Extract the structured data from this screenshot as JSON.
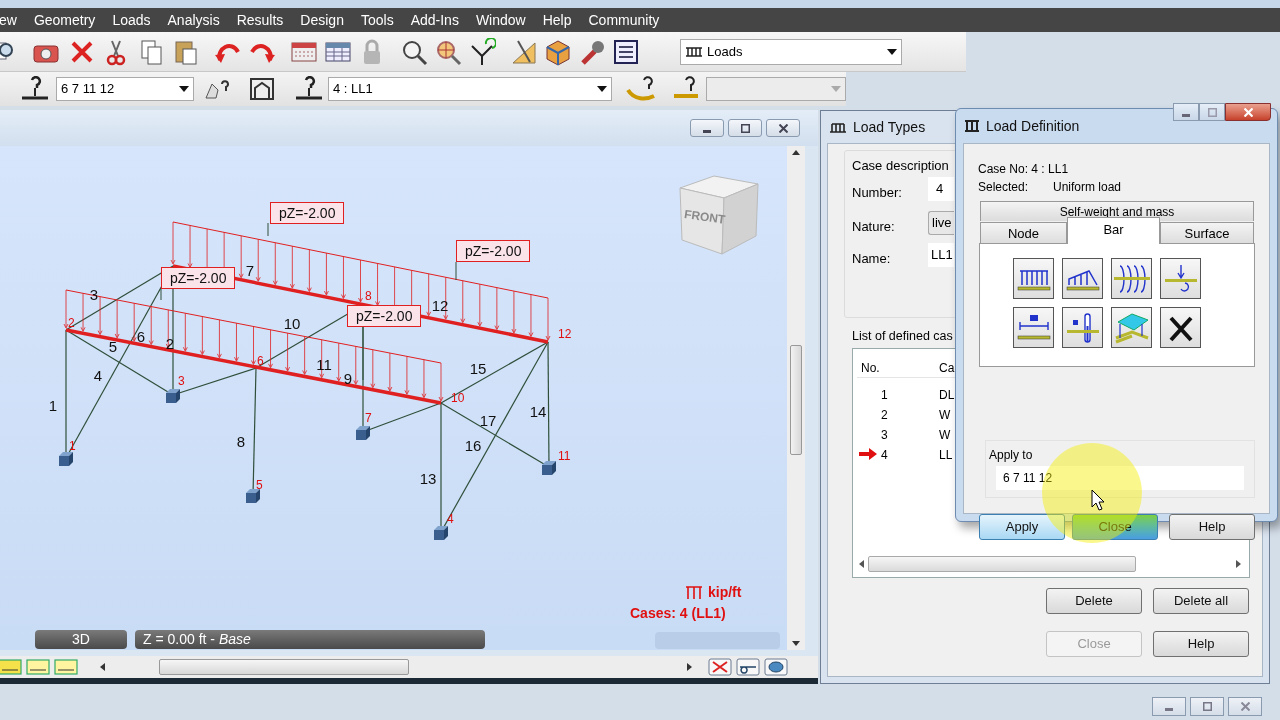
{
  "menu": [
    "ew",
    "Geometry",
    "Loads",
    "Analysis",
    "Results",
    "Design",
    "Tools",
    "Add-Ins",
    "Window",
    "Help",
    "Community"
  ],
  "toolbar": {
    "layout_dropdown": "Loads",
    "selection_combo": "6 7 11 12",
    "case_combo": "4 : LL1",
    "extra_combo": {
      "disabled": true
    }
  },
  "viewport": {
    "load_labels": [
      "pZ=-2.00",
      "pZ=-2.00",
      "pZ=-2.00",
      "pZ=-2.00"
    ],
    "member_labels": [
      "1",
      "2",
      "3",
      "4",
      "5",
      "6",
      "7",
      "8",
      "9",
      "10",
      "11",
      "12",
      "13",
      "14",
      "15",
      "16",
      "17"
    ],
    "node_labels": [
      "1",
      "2",
      "3",
      "4",
      "5",
      "6",
      "7",
      "8",
      "10",
      "11",
      "12"
    ],
    "view_cube": "FRONT",
    "unit": "kip/ft",
    "cases": "Cases: 4 (LL1)",
    "view_tab": "3D",
    "level_tab": "Z = 0.00 ft - *Base*"
  },
  "load_types": {
    "title": "Load Types",
    "group": "Case description",
    "number_label": "Number:",
    "number": "4",
    "nature_label": "Nature:",
    "nature": "live",
    "name_label": "Name:",
    "name": "LL1",
    "list_label": "List of defined cas",
    "columns": [
      "No.",
      "Ca"
    ],
    "rows": [
      {
        "no": "1",
        "case": "DL",
        "selected": false
      },
      {
        "no": "2",
        "case": "W",
        "selected": false
      },
      {
        "no": "3",
        "case": "W",
        "selected": false
      },
      {
        "no": "4",
        "case": "LL",
        "selected": true
      }
    ],
    "buttons": [
      {
        "label": "Delete",
        "disabled": false
      },
      {
        "label": "Delete all",
        "disabled": false
      },
      {
        "label": "Close",
        "disabled": true
      },
      {
        "label": "Help",
        "disabled": false
      }
    ]
  },
  "load_definition": {
    "title": "Load Definition",
    "case_no": "Case No: 4 : LL1",
    "selected_label": "Selected:",
    "selected_value": "Uniform load",
    "wide_tab": {
      "label": "Self-weight and mass",
      "selected": false
    },
    "tabs": [
      {
        "label": "Node",
        "selected": false
      },
      {
        "label": "Bar",
        "selected": true
      },
      {
        "label": "Surface",
        "selected": false
      }
    ],
    "apply_label": "Apply to",
    "apply_value": "6 7 11 12",
    "buttons": [
      {
        "label": "Apply",
        "kind": "default"
      },
      {
        "label": "Close",
        "kind": "hover"
      },
      {
        "label": "Help",
        "kind": "normal"
      }
    ]
  }
}
